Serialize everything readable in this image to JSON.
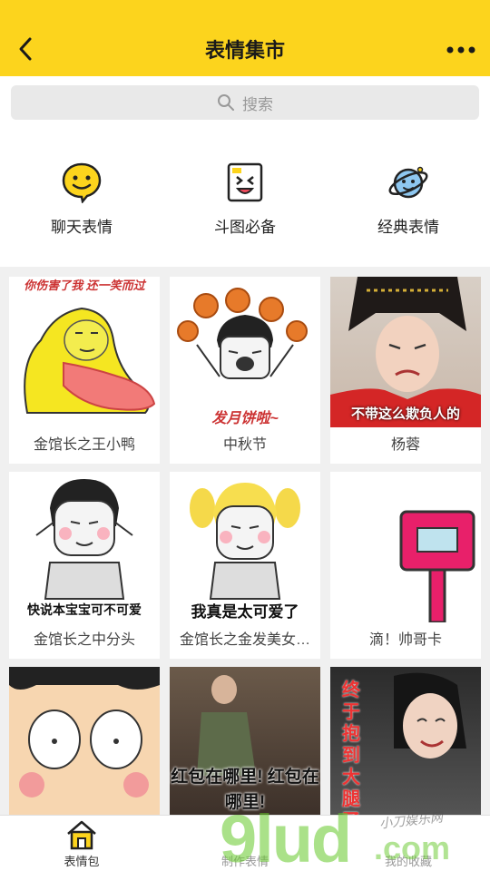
{
  "header": {
    "title": "表情集市",
    "back_icon": "chevron-left-icon",
    "more_icon": "ellipsis-icon"
  },
  "search": {
    "placeholder": "搜索"
  },
  "categories": [
    {
      "label": "聊天表情",
      "icon": "chat-smiley-icon"
    },
    {
      "label": "斗图必备",
      "icon": "meme-face-icon"
    },
    {
      "label": "经典表情",
      "icon": "planet-icon"
    }
  ],
  "cards": [
    {
      "name": "金馆长之王小鸭",
      "caption": "你伤害了我 还一笑而过"
    },
    {
      "name": "中秋节",
      "caption": "发月饼啦~"
    },
    {
      "name": "杨蓉",
      "caption": "不带这么欺负人的"
    },
    {
      "name": "金馆长之中分头",
      "caption": "快说本宝宝可不可爱"
    },
    {
      "name": "金馆长之金发美女…",
      "caption": "我真是太可爱了"
    },
    {
      "name": "滴！帅哥卡",
      "caption": ""
    },
    {
      "name": "",
      "caption": ""
    },
    {
      "name": "",
      "caption": "红包在哪里! 红包在哪里!"
    },
    {
      "name": "",
      "caption": "终于抱到大腿了"
    }
  ],
  "tabbar": {
    "tabs": [
      {
        "label": "表情包",
        "icon": "home-icon",
        "active": true
      },
      {
        "label": "制作表情",
        "icon": "",
        "active": false
      },
      {
        "label": "我的收藏",
        "icon": "",
        "active": false
      }
    ]
  },
  "watermark": {
    "main": "9lud",
    "suffix": ".com",
    "small": "小刀娱乐网"
  },
  "colors": {
    "accent": "#fcd41d",
    "background": "#f0f0f0"
  }
}
